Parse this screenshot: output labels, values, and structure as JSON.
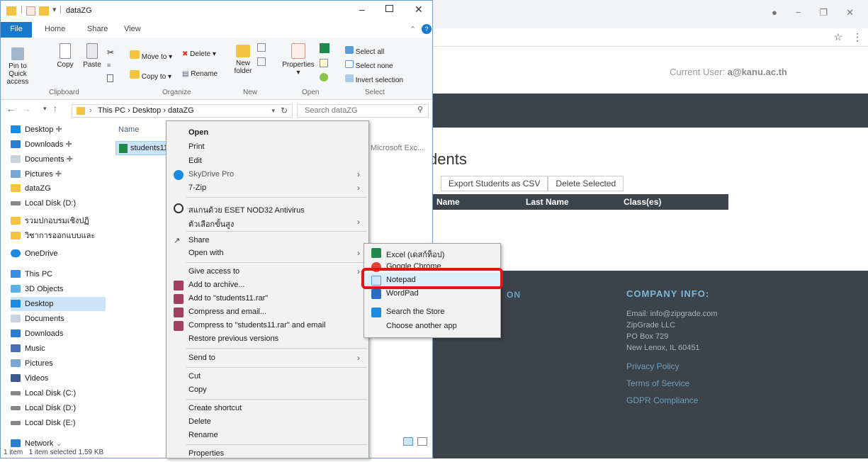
{
  "browser": {
    "window_controls": [
      "−",
      "❐",
      "✕"
    ],
    "current_user_label": "Current User:",
    "current_user": "a@kanu.ac.th",
    "page_title": "dents",
    "buttons": [
      "Export Students as CSV",
      "Delete Selected"
    ],
    "table_headers": [
      "Name",
      "Last Name",
      "Class(es)"
    ],
    "footer_left_heading": "ON",
    "company_heading": "COMPANY INFO:",
    "company_lines": [
      "Email: info@zipgrade.com",
      "ZipGrade LLC",
      "PO Box 729",
      "New Lenox, IL 60451"
    ],
    "footer_links": [
      "Privacy Policy",
      "Terms of Service",
      "GDPR Compliance"
    ]
  },
  "explorer": {
    "title": "dataZG",
    "ribbon_tabs": [
      "File",
      "Home",
      "Share",
      "View"
    ],
    "ribbon": {
      "clipboard": {
        "label": "Clipboard",
        "pin": "Pin to Quick access",
        "copy": "Copy",
        "paste": "Paste"
      },
      "organize": {
        "label": "Organize",
        "move_to": "Move to",
        "copy_to": "Copy to",
        "delete": "Delete",
        "rename": "Rename"
      },
      "new": {
        "label": "New",
        "new_folder": "New folder"
      },
      "open": {
        "label": "Open",
        "properties": "Properties"
      },
      "select": {
        "label": "Select",
        "select_all": "Select all",
        "select_none": "Select none",
        "invert": "Invert selection"
      }
    },
    "breadcrumb": [
      "This PC",
      "Desktop",
      "dataZG"
    ],
    "search_placeholder": "Search dataZG",
    "column_name": "Name",
    "file_name": "students11",
    "file_type": "Microsoft Exc...",
    "nav_items": [
      "Desktop",
      "Downloads",
      "Documents",
      "Pictures",
      "dataZG",
      "Local Disk (D:)",
      "รวมปกอบรมเชิงปฏิ",
      "วิชาการออกแบบและ",
      "OneDrive",
      "This PC",
      "3D Objects",
      "Desktop",
      "Documents",
      "Downloads",
      "Music",
      "Pictures",
      "Videos",
      "Local Disk (C:)",
      "Local Disk (D:)",
      "Local Disk (E:)",
      "Network"
    ],
    "status": [
      "1 item",
      "1 item selected 1.59 KB"
    ]
  },
  "context_menu": [
    "Open",
    "Print",
    "Edit",
    "SkyDrive Pro",
    "7-Zip",
    "สแกนด้วย ESET NOD32 Antivirus",
    "ตัวเลือกขั้นสูง",
    "Share",
    "Open with",
    "Give access to",
    "Add to archive...",
    "Add to \"students11.rar\"",
    "Compress and email...",
    "Compress to \"students11.rar\" and email",
    "Restore previous versions",
    "Send to",
    "Cut",
    "Copy",
    "Create shortcut",
    "Delete",
    "Rename",
    "Properties"
  ],
  "open_with_menu": [
    "Excel (เดสก์ท็อป)",
    "Google Chrome",
    "Notepad",
    "WordPad",
    "Search the Store",
    "Choose another app"
  ],
  "highlighted_item": "Notepad",
  "colors": {
    "highlight": "#e01515",
    "file_tab": "#1979ca",
    "dark_band": "#3c434a"
  }
}
